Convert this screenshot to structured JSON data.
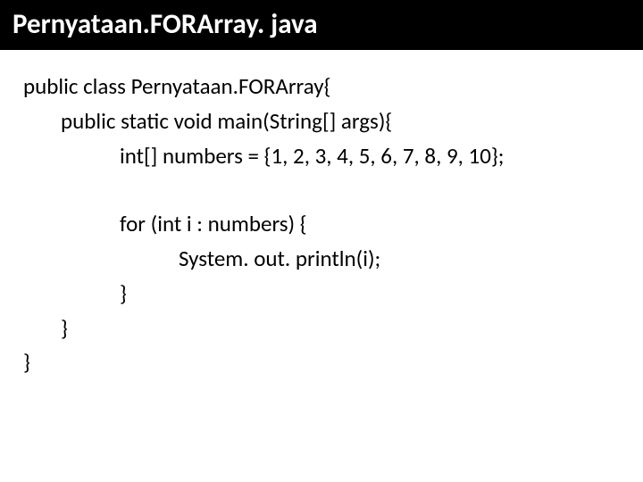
{
  "title": "Pernyataan.FORArray. java",
  "code": {
    "l1": "public class Pernyataan.FORArray{",
    "l2": "public static void main(String[] args){",
    "l3": "int[] numbers = {1, 2, 3, 4, 5, 6, 7, 8, 9, 10};",
    "l4": "for (int i : numbers) {",
    "l5": "System. out. println(i);",
    "l6": "}",
    "l7": "}",
    "l8": "}"
  }
}
